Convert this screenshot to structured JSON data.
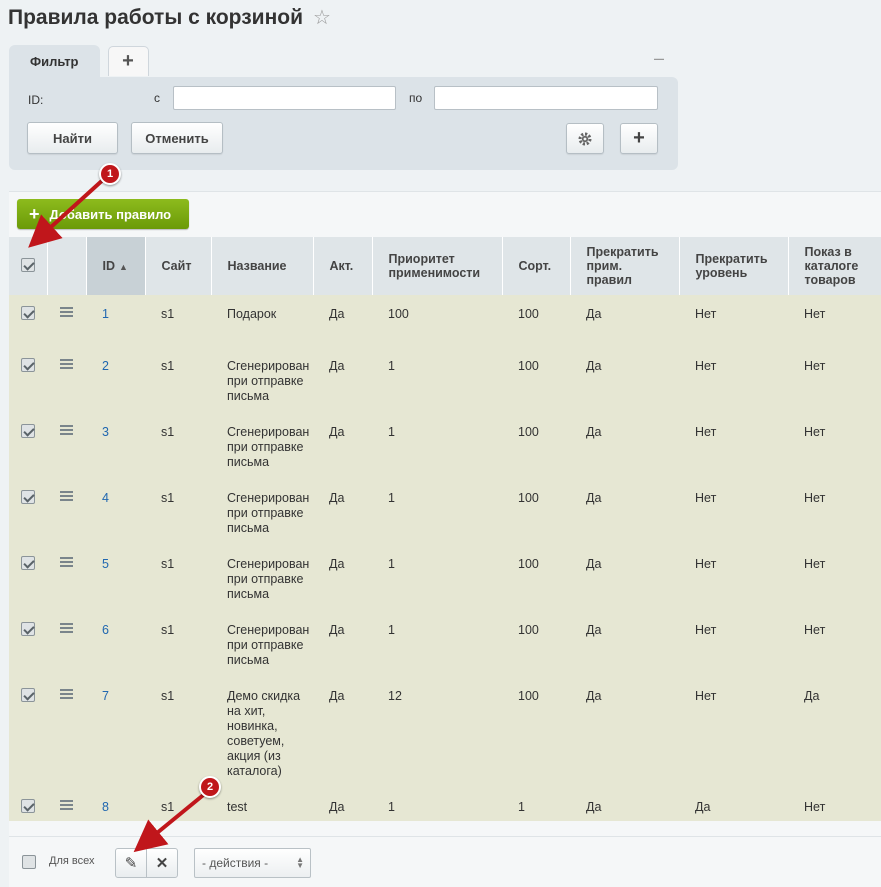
{
  "page": {
    "title": "Правила работы с корзиной"
  },
  "filter": {
    "tab_label": "Фильтр",
    "add_tab_icon": "+",
    "minimize_icon": "–",
    "id_label": "ID:",
    "from_label": "с",
    "to_label": "по",
    "from_value": "",
    "to_value": "",
    "find_label": "Найти",
    "cancel_label": "Отменить",
    "add_field_icon": "+"
  },
  "toolbar": {
    "add_rule_label": "Добавить правило"
  },
  "grid": {
    "columns": {
      "id": "ID",
      "site": "Сайт",
      "name": "Название",
      "active": "Акт.",
      "priority": "Приоритет применимости",
      "sort": "Сорт.",
      "stop_rules": "Прекратить прим. правил",
      "stop_level": "Прекратить уровень",
      "show_catalog": "Показ в каталоге товаров"
    },
    "rows": [
      {
        "id": "1",
        "site": "s1",
        "name": "Подарок",
        "active": "Да",
        "priority": "100",
        "sort": "100",
        "stop_rules": "Да",
        "stop_level": "Нет",
        "show_catalog": "Нет"
      },
      {
        "id": "2",
        "site": "s1",
        "name": "Сгенерирован при отправке письма",
        "active": "Да",
        "priority": "1",
        "sort": "100",
        "stop_rules": "Да",
        "stop_level": "Нет",
        "show_catalog": "Нет"
      },
      {
        "id": "3",
        "site": "s1",
        "name": "Сгенерирован при отправке письма",
        "active": "Да",
        "priority": "1",
        "sort": "100",
        "stop_rules": "Да",
        "stop_level": "Нет",
        "show_catalog": "Нет"
      },
      {
        "id": "4",
        "site": "s1",
        "name": "Сгенерирован при отправке письма",
        "active": "Да",
        "priority": "1",
        "sort": "100",
        "stop_rules": "Да",
        "stop_level": "Нет",
        "show_catalog": "Нет"
      },
      {
        "id": "5",
        "site": "s1",
        "name": "Сгенерирован при отправке письма",
        "active": "Да",
        "priority": "1",
        "sort": "100",
        "stop_rules": "Да",
        "stop_level": "Нет",
        "show_catalog": "Нет"
      },
      {
        "id": "6",
        "site": "s1",
        "name": "Сгенерирован при отправке письма",
        "active": "Да",
        "priority": "1",
        "sort": "100",
        "stop_rules": "Да",
        "stop_level": "Нет",
        "show_catalog": "Нет"
      },
      {
        "id": "7",
        "site": "s1",
        "name": "Демо скидка на хит, новинка, советуем, акция (из каталога)",
        "active": "Да",
        "priority": "12",
        "sort": "100",
        "stop_rules": "Да",
        "stop_level": "Нет",
        "show_catalog": "Да"
      },
      {
        "id": "8",
        "site": "s1",
        "name": "test",
        "active": "Да",
        "priority": "1",
        "sort": "1",
        "stop_rules": "Да",
        "stop_level": "Да",
        "show_catalog": "Нет"
      }
    ]
  },
  "footer": {
    "for_all_label": "Для всех",
    "actions_label": "- действия -"
  },
  "annotations": {
    "badge1": "1",
    "badge2": "2",
    "color": "#c0161b"
  }
}
